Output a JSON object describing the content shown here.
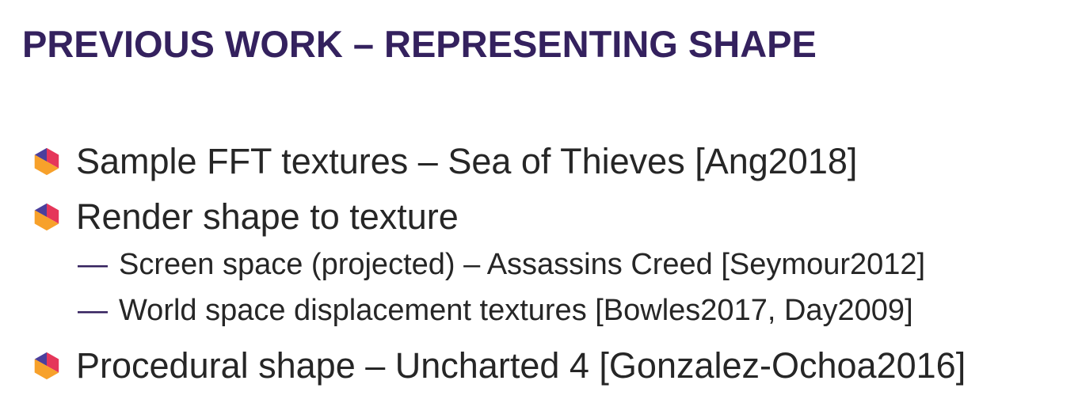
{
  "slide": {
    "title": "PREVIOUS WORK – REPRESENTING SHAPE",
    "bullet_icon": "hexagon-cube-icon",
    "colors": {
      "title": "#34215e",
      "text": "#262626",
      "icon_left": "#4b3f9c",
      "icon_right": "#e5365a",
      "icon_bottom": "#f7a12b"
    },
    "bullets": [
      {
        "text": "Sample FFT textures – Sea of Thieves [Ang2018]"
      },
      {
        "text": "Render shape to texture",
        "subitems": [
          {
            "dash": "—",
            "text": "Screen space (projected) – Assassins Creed [Seymour2012]"
          },
          {
            "dash": "—",
            "text": "World space displacement textures [Bowles2017, Day2009]"
          }
        ]
      },
      {
        "text": "Procedural shape – Uncharted 4 [Gonzalez-Ochoa2016]"
      }
    ]
  }
}
